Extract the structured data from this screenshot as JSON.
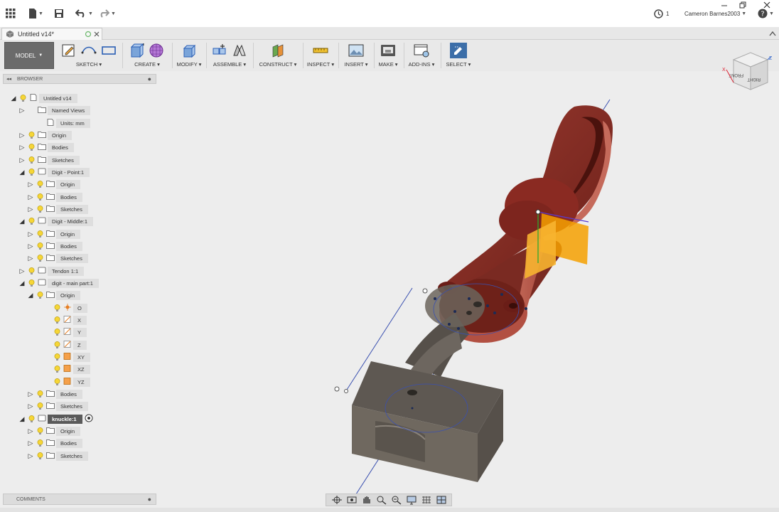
{
  "titlebar": {
    "jobs_count": "1",
    "user_name": "Cameron Barnes2003",
    "icons": [
      "apps-grid-icon",
      "file-icon",
      "save-icon",
      "undo-icon",
      "redo-icon",
      "job-status-icon",
      "help-icon",
      "minimize-icon",
      "restore-icon",
      "close-icon"
    ]
  },
  "tab": {
    "title": "Untitled v14*"
  },
  "toolbar": {
    "workspace": "MODEL",
    "groups": {
      "sketch": "SKETCH",
      "create": "CREATE",
      "modify": "MODIFY",
      "assemble": "ASSEMBLE",
      "construct": "CONSTRUCT",
      "inspect": "INSPECT",
      "insert": "INSERT",
      "make": "MAKE",
      "addins": "ADD-INS",
      "select": "SELECT"
    }
  },
  "browser": {
    "title": "BROWSER",
    "nodes": [
      {
        "label": "Untitled v14"
      },
      {
        "label": "Named Views"
      },
      {
        "label": "Units: mm"
      },
      {
        "label": "Origin"
      },
      {
        "label": "Bodies"
      },
      {
        "label": "Sketches"
      },
      {
        "label": "Digit - Point:1"
      },
      {
        "label": "Origin"
      },
      {
        "label": "Bodies"
      },
      {
        "label": "Sketches"
      },
      {
        "label": "Digit - Middle:1"
      },
      {
        "label": "Origin"
      },
      {
        "label": "Bodies"
      },
      {
        "label": "Sketches"
      },
      {
        "label": "Tendon 1:1"
      },
      {
        "label": "digit - main part:1"
      },
      {
        "label": "Origin"
      },
      {
        "label": "O"
      },
      {
        "label": "X"
      },
      {
        "label": "Y"
      },
      {
        "label": "Z"
      },
      {
        "label": "XY"
      },
      {
        "label": "XZ"
      },
      {
        "label": "YZ"
      },
      {
        "label": "Bodies"
      },
      {
        "label": "Sketches"
      },
      {
        "label": "knuckle:1"
      },
      {
        "label": "Origin"
      },
      {
        "label": "Bodies"
      },
      {
        "label": "Sketches"
      }
    ]
  },
  "comments": {
    "title": "COMMENTS"
  },
  "viewcube": {
    "faces": [
      "FRONT",
      "RIGHT"
    ],
    "axes": [
      "X",
      "Z"
    ]
  },
  "colors": {
    "red_part": "#8a2a22",
    "dark_part": "#56504a",
    "plane": "#f5a000",
    "axis_line": "#3a50b0",
    "workspace_button": "#6b6b6b"
  }
}
